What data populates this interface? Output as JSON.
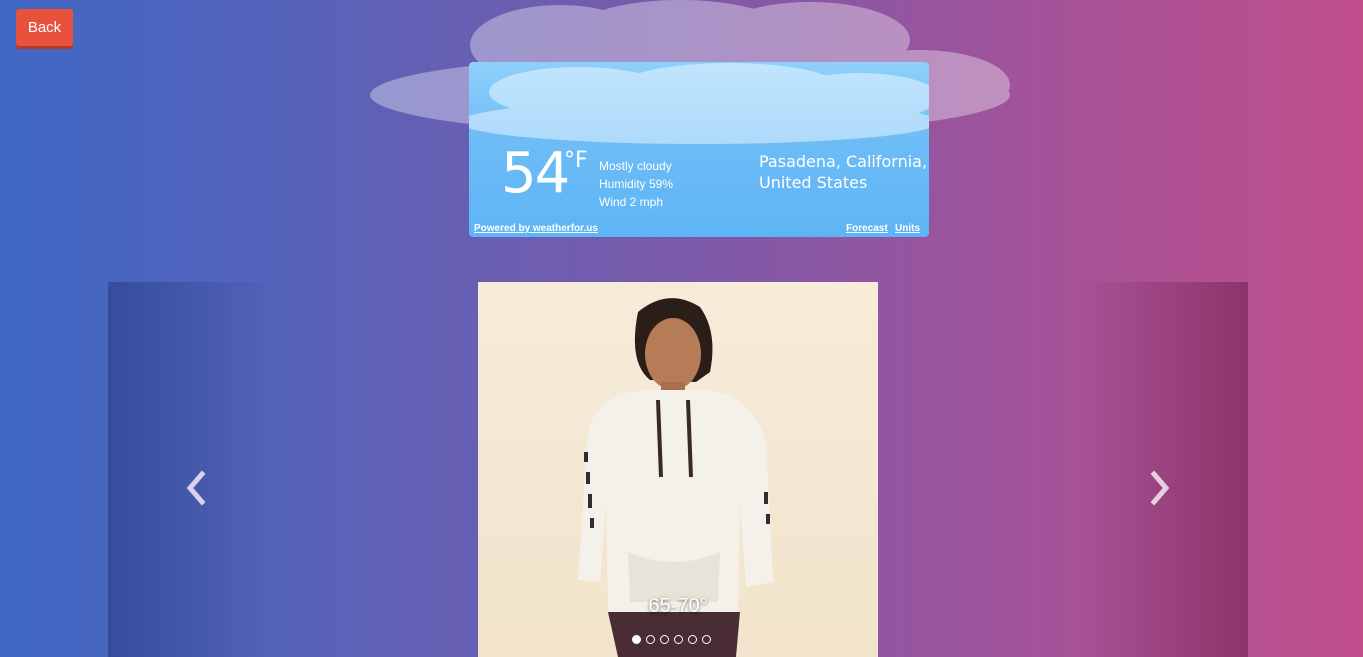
{
  "nav": {
    "back_label": "Back"
  },
  "weather": {
    "temperature": "54",
    "unit": "°F",
    "condition": "Mostly cloudy",
    "humidity": "Humidity 59%",
    "wind": "Wind 2 mph",
    "location_line1": "Pasadena, California,",
    "location_line2": "United States",
    "powered_by": "Powered by weatherfor.us",
    "forecast_link": "Forecast",
    "units_link": "Units"
  },
  "carousel": {
    "caption": "65-70°",
    "dot_count": 6,
    "active_dot_index": 0,
    "prev_icon": "chevron-left-icon",
    "next_icon": "chevron-right-icon"
  },
  "colors": {
    "back_button": "#e8523c",
    "weather_card": "#5eb5f5",
    "background_left": "#3f67c4",
    "background_right": "#c04e8a"
  }
}
